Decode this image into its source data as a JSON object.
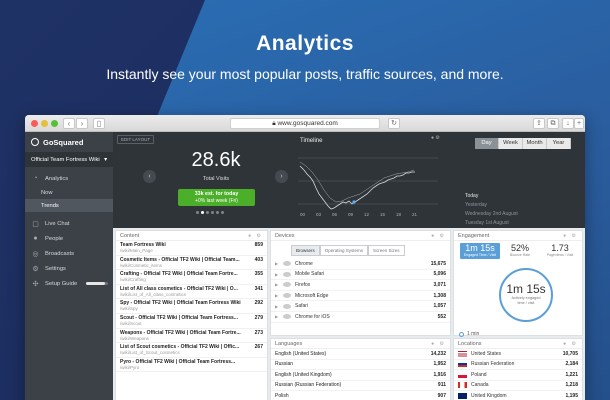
{
  "hero": {
    "title": "Analytics",
    "subtitle": "Instantly see your most popular posts, traffic sources, and more."
  },
  "browser": {
    "url": "www.gosquared.com"
  },
  "sidebar": {
    "logo": "GoSquared",
    "site": "Official Team Fortress Wiki",
    "items": [
      {
        "label": "Analytics",
        "icon": "analytics-icon"
      },
      {
        "label": "Now",
        "sub": true
      },
      {
        "label": "Trends",
        "sub": true,
        "active": true
      },
      {
        "label": "Live Chat",
        "icon": "chat-icon"
      },
      {
        "label": "People",
        "icon": "people-icon"
      },
      {
        "label": "Broadcasts",
        "icon": "broadcast-icon"
      },
      {
        "label": "Settings",
        "icon": "gear-icon"
      },
      {
        "label": "Setup Guide",
        "icon": "setup-icon"
      }
    ],
    "setup_progress": 0.85
  },
  "overview": {
    "edit_layout": "EDIT LAYOUT",
    "total": "28.6k",
    "total_label": "Total Visits",
    "estimate": "33k est. for today",
    "estimate_change": "+0% last week (Fri)"
  },
  "timeline": {
    "title": "Timeline",
    "tick_labels": [
      "00",
      "03",
      "06",
      "09",
      "12",
      "15",
      "18",
      "21"
    ]
  },
  "range": {
    "tabs": [
      "Day",
      "Week",
      "Month",
      "Year"
    ],
    "active_tab": "Day",
    "list": [
      "Today",
      "Yesterday",
      "Wednesday 2nd August",
      "Tuesday 1st August"
    ]
  },
  "content": {
    "title": "Content",
    "rows": [
      {
        "title": "Team Fortress Wiki",
        "path": "/wiki/Main_Page",
        "count": "859"
      },
      {
        "title": "Cosmetic Items - Official TF2 Wiki | Official Team...",
        "path": "/wiki/Cosmetic_items",
        "count": "403"
      },
      {
        "title": "Crafting - Official TF2 Wiki | Official Team Fortre...",
        "path": "/wiki/Crafting",
        "count": "355"
      },
      {
        "title": "List of All class cosmetics - Official TF2 Wiki | O...",
        "path": "/wiki/List_of_All_class_cosmetics",
        "count": "341"
      },
      {
        "title": "Spy - Official TF2 Wiki | Official Team Fortress Wiki",
        "path": "/wiki/Spy",
        "count": "292"
      },
      {
        "title": "Scout - Official TF2 Wiki | Official Team Fortress...",
        "path": "/wiki/Scout",
        "count": "279"
      },
      {
        "title": "Weapons - Official TF2 Wiki | Official Team Fortre...",
        "path": "/wiki/Weapons",
        "count": "273"
      },
      {
        "title": "List of Scout cosmetics - Official TF2 Wiki | Offic...",
        "path": "/wiki/List_of_Scout_cosmetics",
        "count": "267"
      },
      {
        "title": "Pyro - Official TF2 Wiki | Official Team Fortress...",
        "path": "/wiki/Pyro",
        "count": ""
      }
    ]
  },
  "devices": {
    "title": "Devices",
    "tabs": [
      "Browsers",
      "Operating Systems",
      "Screen Sizes"
    ],
    "rows": [
      {
        "name": "Chrome",
        "count": "15,675"
      },
      {
        "name": "Mobile Safari",
        "count": "5,096"
      },
      {
        "name": "Firefox",
        "count": "3,071"
      },
      {
        "name": "Microsoft Edge",
        "count": "1,308"
      },
      {
        "name": "Safari",
        "count": "1,057"
      },
      {
        "name": "Chrome for iOS",
        "count": "552"
      }
    ]
  },
  "languages": {
    "title": "Languages",
    "rows": [
      {
        "name": "English (United States)",
        "count": "14,232"
      },
      {
        "name": "Russian",
        "count": "1,952"
      },
      {
        "name": "English (United Kingdom)",
        "count": "1,916"
      },
      {
        "name": "Russian (Russian Federation)",
        "count": "911"
      },
      {
        "name": "Polish",
        "count": "907"
      }
    ]
  },
  "engagement": {
    "title": "Engagement",
    "engaged_time": "1m 15s",
    "engaged_label": "Engaged Time / Visit",
    "bounce": "52%",
    "bounce_label": "Bounce Rate",
    "pageviews": "1.73",
    "pageviews_label": "Pageviews / Visit",
    "circle_value": "1m 15s",
    "circle_label_1": "Actively engaged",
    "circle_label_2": "time / visit",
    "legend": "1 min"
  },
  "locations": {
    "title": "Locations",
    "rows": [
      {
        "name": "United States",
        "count": "10,705",
        "flag": "us-flag-icon"
      },
      {
        "name": "Russian Federation",
        "count": "2,184",
        "flag": "ru-flag-icon"
      },
      {
        "name": "Poland",
        "count": "1,221",
        "flag": "pl-flag-icon"
      },
      {
        "name": "Canada",
        "count": "1,218",
        "flag": "ca-flag-icon"
      },
      {
        "name": "United Kingdom",
        "count": "1,195",
        "flag": "gb-flag-icon"
      }
    ]
  }
}
